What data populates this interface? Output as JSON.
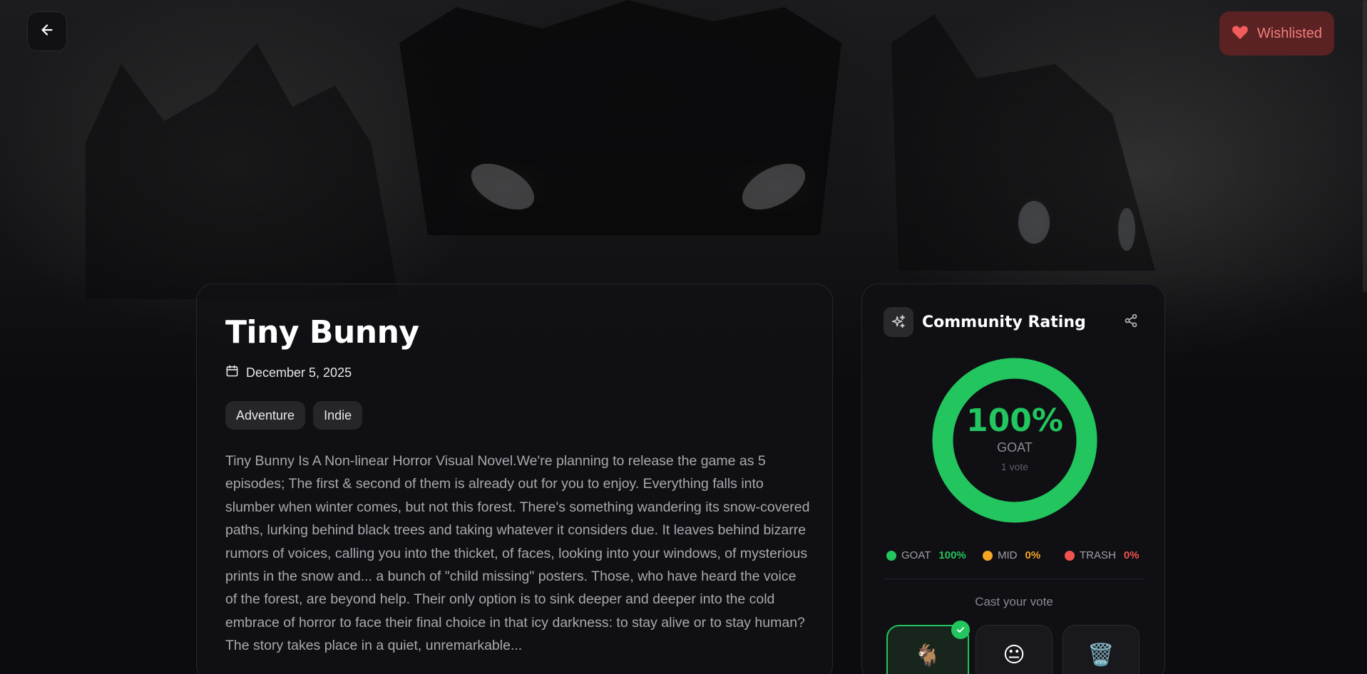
{
  "header": {
    "back_label": "",
    "wishlist": {
      "label": "Wishlisted",
      "color": "#f47d7a",
      "bg": "#5a2223"
    }
  },
  "game": {
    "title": "Tiny Bunny",
    "release_date": "December 5, 2025",
    "tags": [
      "Adventure",
      "Indie"
    ],
    "description": "Tiny Bunny Is A Non-linear Horror Visual Novel.We're planning to release the game as 5 episodes; The first & second of them is already out for you to enjoy. Everything falls into slumber when winter comes, but not this forest. There's something wandering its snow-covered paths, lurking behind black trees and taking whatever it considers due. It leaves behind bizarre rumors of voices, calling you into the thicket, of faces, looking into your windows, of mysterious prints in the snow and... a bunch of \"child missing\" posters. Those, who have heard the voice of the forest, are beyond help. Their only option is to sink deeper and deeper into the cold embrace of horror to face their final choice in that icy darkness: to stay alive or to stay human? The story takes place in a quiet, unremarkable..."
  },
  "rating": {
    "title": "Community Rating",
    "percent": "100%",
    "percent_value": 1.0,
    "label": "GOAT",
    "votes": "1 vote",
    "legend": [
      {
        "name": "GOAT",
        "value": "100%",
        "color": "#22c55e"
      },
      {
        "name": "MID",
        "value": "0%",
        "color": "#f5a524"
      },
      {
        "name": "TRASH",
        "value": "0%",
        "color": "#ef5350"
      }
    ],
    "cast_label": "Cast your vote",
    "vote_options": [
      {
        "name": "goat",
        "emoji": "🐐",
        "selected": true
      },
      {
        "name": "mid",
        "emoji": "😐",
        "selected": false
      },
      {
        "name": "trash",
        "emoji": "🗑️",
        "selected": false
      }
    ]
  },
  "colors": {
    "accent_green": "#22c55e",
    "background": "#0b0b0e"
  },
  "icons": [
    "back-arrow-icon",
    "heart-icon",
    "calendar-icon",
    "sparkle-icon",
    "share-icon",
    "check-icon"
  ]
}
